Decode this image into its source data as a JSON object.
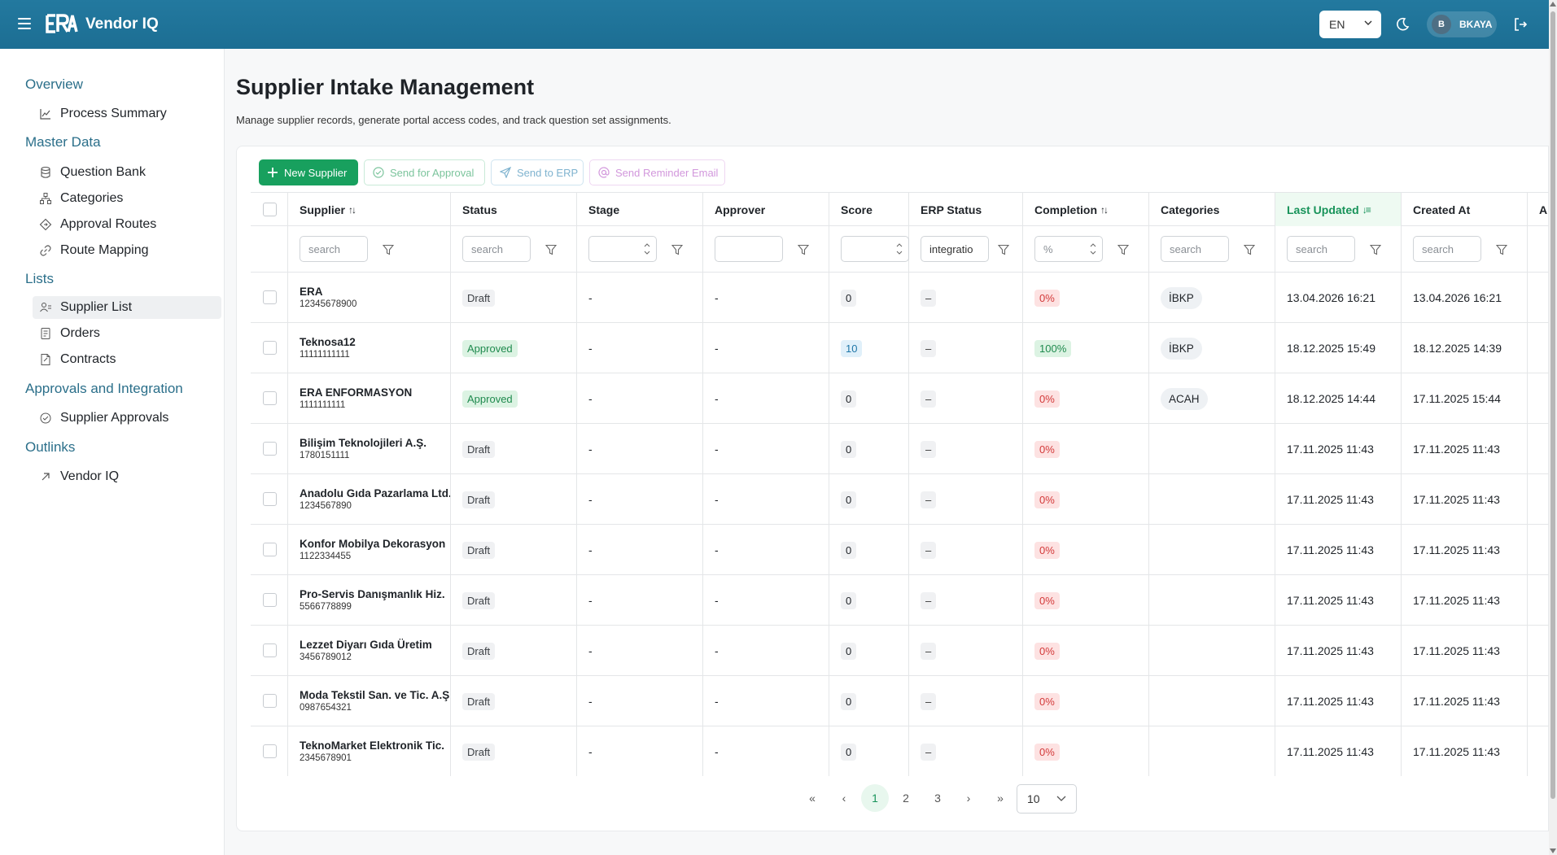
{
  "header": {
    "app_title": "Vendor IQ",
    "logo_text": "ERA",
    "language": "EN",
    "user_initial": "B",
    "user_name": "BKAYA"
  },
  "sidebar": {
    "sections": [
      {
        "title": "Overview",
        "items": [
          {
            "label": "Process Summary",
            "icon": "chart-line-icon"
          }
        ]
      },
      {
        "title": "Master Data",
        "items": [
          {
            "label": "Question Bank",
            "icon": "database-icon"
          },
          {
            "label": "Categories",
            "icon": "hierarchy-icon"
          },
          {
            "label": "Approval Routes",
            "icon": "diamond-route-icon"
          },
          {
            "label": "Route Mapping",
            "icon": "link-icon"
          }
        ]
      },
      {
        "title": "Lists",
        "items": [
          {
            "label": "Supplier List",
            "icon": "user-list-icon",
            "active": true
          },
          {
            "label": "Orders",
            "icon": "document-icon"
          },
          {
            "label": "Contracts",
            "icon": "contract-icon"
          }
        ]
      },
      {
        "title": "Approvals and Integration",
        "items": [
          {
            "label": "Supplier Approvals",
            "icon": "check-circle-icon"
          }
        ]
      },
      {
        "title": "Outlinks",
        "items": [
          {
            "label": "Vendor IQ",
            "icon": "external-arrow-icon"
          }
        ]
      }
    ]
  },
  "page": {
    "title": "Supplier Intake Management",
    "subtitle": "Manage supplier records, generate portal access codes, and track question set assignments."
  },
  "toolbar": {
    "new_supplier": "New Supplier",
    "send_for_approval": "Send for Approval",
    "send_to_erp": "Send to ERP",
    "send_reminder": "Send Reminder Email"
  },
  "table": {
    "columns": {
      "supplier": "Supplier",
      "status": "Status",
      "stage": "Stage",
      "approver": "Approver",
      "score": "Score",
      "erp_status": "ERP Status",
      "completion": "Completion",
      "categories": "Categories",
      "last_updated": "Last Updated",
      "created_at": "Created At",
      "next": "A"
    },
    "filters": {
      "supplier": "search",
      "status": "search",
      "erp_status": "integratio",
      "completion": "%",
      "categories": "search",
      "last_updated": "search",
      "created_at": "search"
    },
    "rows": [
      {
        "name": "ERA",
        "code": "12345678900",
        "status": "Draft",
        "stage": "-",
        "approver": "-",
        "score": "0",
        "erp": "–",
        "completion": "0%",
        "category": "İBKP",
        "updated": "13.04.2026 16:21",
        "created": "13.04.2026 16:21"
      },
      {
        "name": "Teknosa12",
        "code": "11111111111",
        "status": "Approved",
        "stage": "-",
        "approver": "-",
        "score": "10",
        "erp": "–",
        "completion": "100%",
        "category": "İBKP",
        "updated": "18.12.2025 15:49",
        "created": "18.12.2025 14:39"
      },
      {
        "name": "ERA ENFORMASYON",
        "code": "1111111111",
        "status": "Approved",
        "stage": "-",
        "approver": "-",
        "score": "0",
        "erp": "–",
        "completion": "0%",
        "category": "ACAH",
        "updated": "18.12.2025 14:44",
        "created": "17.11.2025 15:44"
      },
      {
        "name": "Bilişim Teknolojileri A.Ş.",
        "code": "1780151111",
        "status": "Draft",
        "stage": "-",
        "approver": "-",
        "score": "0",
        "erp": "–",
        "completion": "0%",
        "category": "",
        "updated": "17.11.2025 11:43",
        "created": "17.11.2025 11:43"
      },
      {
        "name": "Anadolu Gıda Pazarlama Ltd.",
        "code": "1234567890",
        "status": "Draft",
        "stage": "-",
        "approver": "-",
        "score": "0",
        "erp": "–",
        "completion": "0%",
        "category": "",
        "updated": "17.11.2025 11:43",
        "created": "17.11.2025 11:43"
      },
      {
        "name": "Konfor Mobilya Dekorasyon",
        "code": "1122334455",
        "status": "Draft",
        "stage": "-",
        "approver": "-",
        "score": "0",
        "erp": "–",
        "completion": "0%",
        "category": "",
        "updated": "17.11.2025 11:43",
        "created": "17.11.2025 11:43"
      },
      {
        "name": "Pro-Servis Danışmanlık Hiz.",
        "code": "5566778899",
        "status": "Draft",
        "stage": "-",
        "approver": "-",
        "score": "0",
        "erp": "–",
        "completion": "0%",
        "category": "",
        "updated": "17.11.2025 11:43",
        "created": "17.11.2025 11:43"
      },
      {
        "name": "Lezzet Diyarı Gıda Üretim",
        "code": "3456789012",
        "status": "Draft",
        "stage": "-",
        "approver": "-",
        "score": "0",
        "erp": "–",
        "completion": "0%",
        "category": "",
        "updated": "17.11.2025 11:43",
        "created": "17.11.2025 11:43"
      },
      {
        "name": "Moda Tekstil San. ve Tic. A.Ş.",
        "code": "0987654321",
        "status": "Draft",
        "stage": "-",
        "approver": "-",
        "score": "0",
        "erp": "–",
        "completion": "0%",
        "category": "",
        "updated": "17.11.2025 11:43",
        "created": "17.11.2025 11:43"
      },
      {
        "name": "TeknoMarket Elektronik Tic.",
        "code": "2345678901",
        "status": "Draft",
        "stage": "-",
        "approver": "-",
        "score": "0",
        "erp": "–",
        "completion": "0%",
        "category": "",
        "updated": "17.11.2025 11:43",
        "created": "17.11.2025 11:43"
      }
    ]
  },
  "pagination": {
    "pages": [
      "1",
      "2",
      "3"
    ],
    "current": "1",
    "page_size": "10",
    "first": "«",
    "prev": "‹",
    "next": "›",
    "last": "»"
  },
  "colors": {
    "header": "#1c6e93",
    "accent_green": "#18a05e",
    "section_title": "#2b6f8a"
  }
}
